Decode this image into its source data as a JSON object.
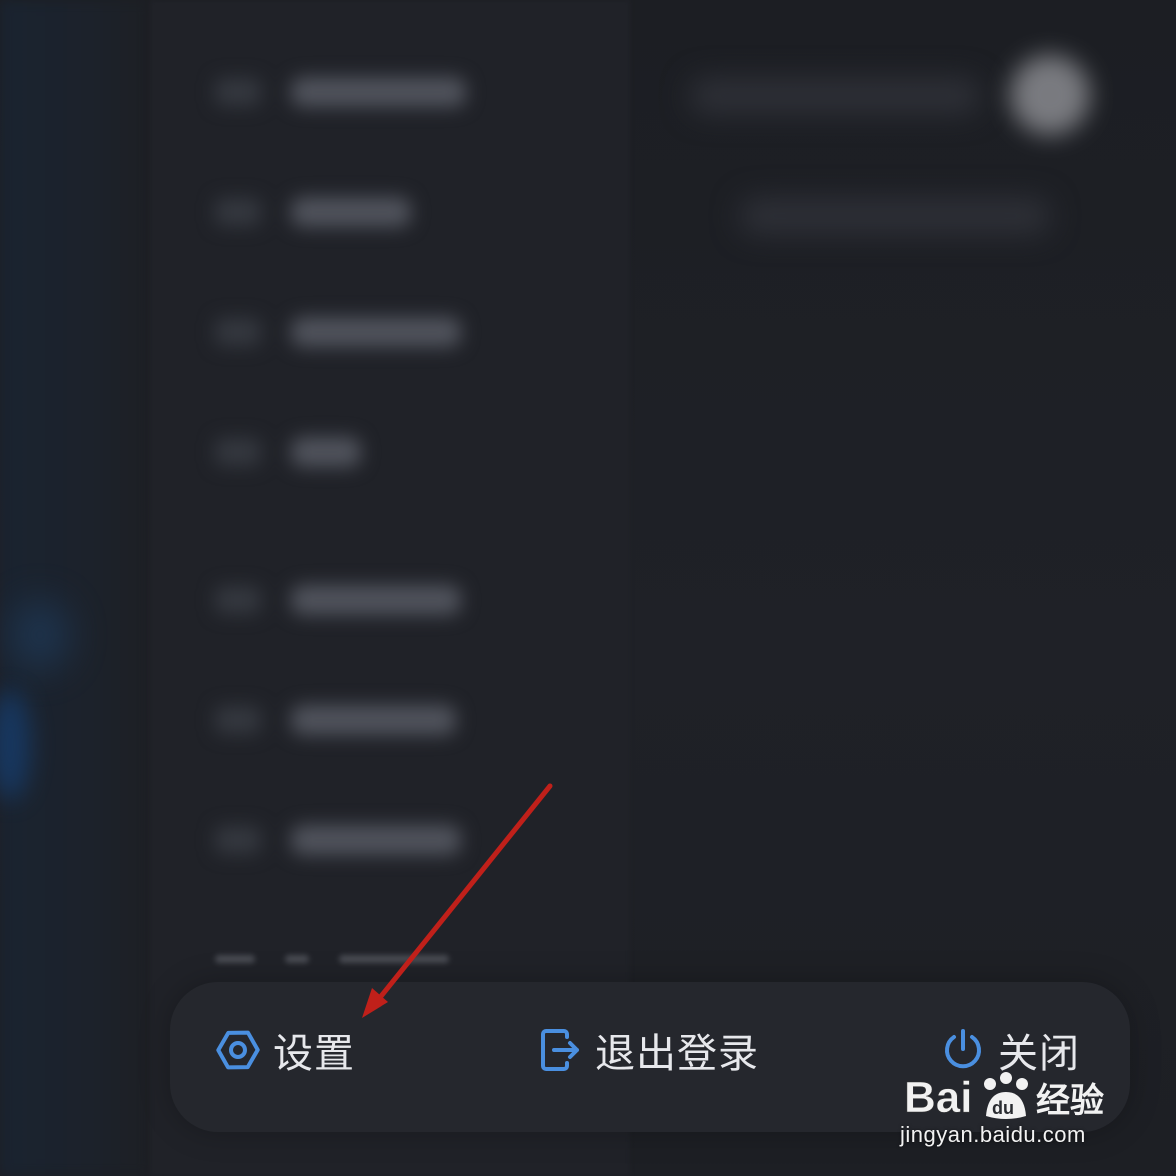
{
  "colors": {
    "background": "#1d1f24",
    "accent_icon": "#4a8fe0",
    "label_text": "#e7e8ec",
    "annotation_arrow": "#c0201a",
    "bottom_bar": "#25272d"
  },
  "bottom_bar": {
    "actions": [
      {
        "label": "设置",
        "icon": "hex-gear-icon"
      },
      {
        "label": "退出登录",
        "icon": "logout-icon"
      },
      {
        "label": "关闭",
        "icon": "power-icon"
      }
    ]
  },
  "watermark": {
    "brand": "Baidu经验",
    "url": "jingyan.baidu.com"
  }
}
